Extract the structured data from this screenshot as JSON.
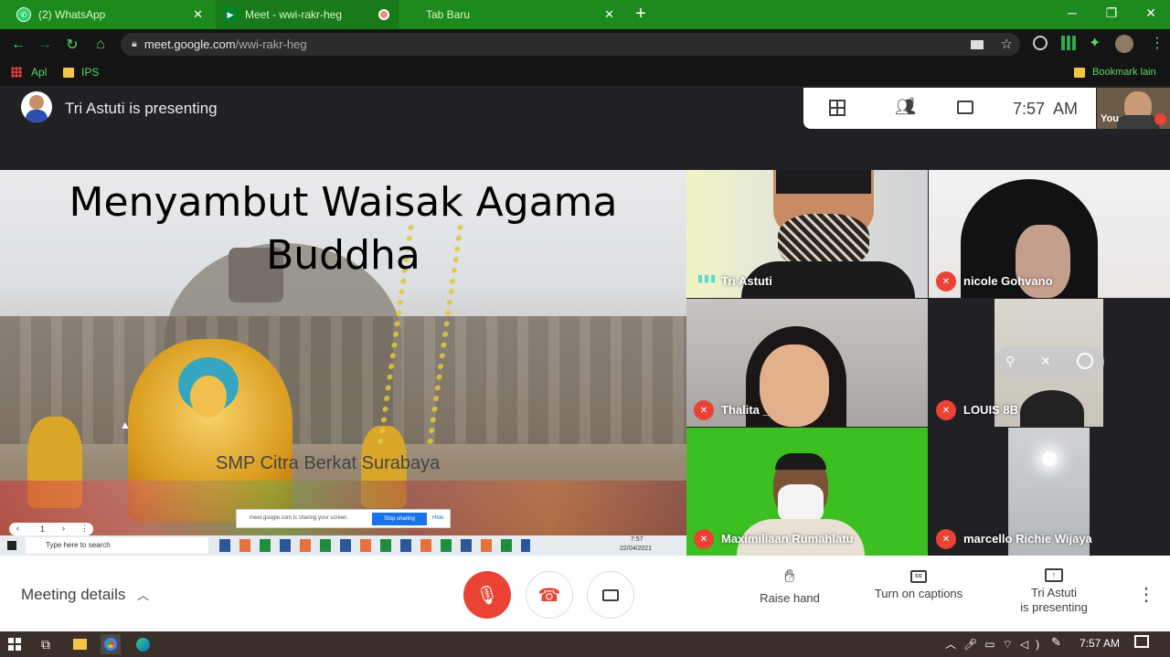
{
  "browser": {
    "tabs": [
      {
        "label": "(2) WhatsApp",
        "icon": "whatsapp-icon"
      },
      {
        "label": "Meet - wwi-rakr-heg",
        "icon": "google-meet-icon"
      },
      {
        "label": "Tab Baru",
        "icon": "none"
      }
    ],
    "address": {
      "host": "meet.google.com",
      "path": "/wwi-rakr-heg"
    },
    "bookmarks": [
      {
        "label": "Apl",
        "icon": "apps-grid-icon"
      },
      {
        "label": "IPS",
        "icon": "folder-icon"
      }
    ],
    "other_bookmarks": "Bookmark lain",
    "theme_color": "#1c8a1c"
  },
  "meet": {
    "presenting_banner": "Tri Astuti is presenting",
    "participants_badge": "8",
    "clock": "7:57  AM",
    "self_label": "You",
    "slide": {
      "title_line1": "Menyambut Waisak Agama",
      "title_line2": "Buddha",
      "subtitle": "SMP Citra Berkat Surabaya",
      "page_number": "1",
      "sharing_notice": "meet.google.com is sharing your screen.",
      "stop_sharing": "Stop sharing",
      "hide": "Hide",
      "search_placeholder": "Type here to search",
      "inner_time": "7:57",
      "inner_date": "22/04/2021"
    },
    "participants": [
      {
        "name": "Tri Astuti",
        "speaking": true,
        "muted": false
      },
      {
        "name": "nicole Gohvano",
        "muted": true
      },
      {
        "name": "Thalita _",
        "muted": true
      },
      {
        "name": "LOUIS 8B",
        "muted": true
      },
      {
        "name": "Maximiliaan Rumahlatu",
        "muted": true
      },
      {
        "name": "marcello Richie Wijaya",
        "muted": true
      }
    ],
    "bottom": {
      "meeting_details": "Meeting details",
      "raise_hand": "Raise hand",
      "captions": "Turn on captions",
      "presenting_line1": "Tri Astuti",
      "presenting_line2": "is presenting"
    },
    "accent_red": "#ea4335"
  },
  "taskbar": {
    "time": "7:57 AM"
  }
}
